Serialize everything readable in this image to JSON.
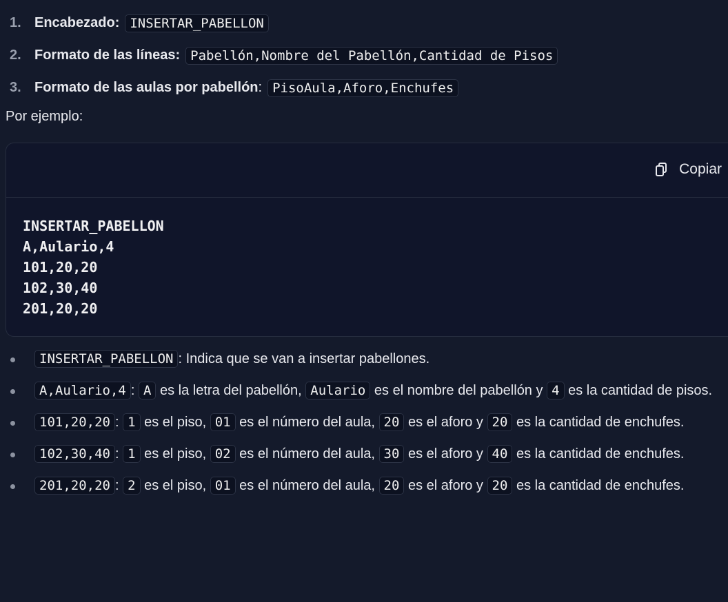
{
  "format_list": [
    {
      "number": "1.",
      "label": "Encabezado:",
      "code": "INSERTAR_PABELLON"
    },
    {
      "number": "2.",
      "label": "Formato de las líneas:",
      "code": "Pabellón,Nombre del Pabellón,Cantidad de Pisos"
    },
    {
      "number": "3.",
      "label": "Formato de las aulas por pabellón",
      "suffix": ":",
      "code": "PisoAula,Aforo,Enchufes"
    }
  ],
  "intro_text": "Por ejemplo:",
  "code_block": {
    "copy_label": "Copiar",
    "copy_icon": "copy-icon",
    "lines": [
      "INSERTAR_PABELLON",
      "A,Aulario,4",
      "101,20,20",
      "102,30,40",
      "201,20,20"
    ]
  },
  "explanations": [
    {
      "code": "INSERTAR_PABELLON",
      "text": ": Indica que se van a insertar pabellones."
    },
    {
      "code": "A,Aulario,4",
      "sep": ":",
      "a_code": "A",
      "a_text": "es la letra del pabellón,",
      "b_code": "Aulario",
      "b_text": "es el nombre del pabellón y",
      "c_code": "4",
      "c_text": "es la cantidad de pisos."
    },
    {
      "code": "101,20,20",
      "sep": ":",
      "piso": "1",
      "piso_text": "es el piso,",
      "aula": "01",
      "aula_text": "es el número del aula,",
      "aforo": "20",
      "aforo_text": "es el aforo y",
      "enchufes": "20",
      "enchufes_text": "es la cantidad de enchufes."
    },
    {
      "code": "102,30,40",
      "sep": ":",
      "piso": "1",
      "piso_text": "es el piso,",
      "aula": "02",
      "aula_text": "es el número del aula,",
      "aforo": "30",
      "aforo_text": "es el aforo y",
      "enchufes": "40",
      "enchufes_text": "es la cantidad de enchufes."
    },
    {
      "code": "201,20,20",
      "sep": ":",
      "piso": "2",
      "piso_text": "es el piso,",
      "aula": "01",
      "aula_text": "es el número del aula,",
      "aforo": "20",
      "aforo_text": "es el aforo y",
      "enchufes": "20",
      "enchufes_text": "es la cantidad de enchufes."
    }
  ]
}
